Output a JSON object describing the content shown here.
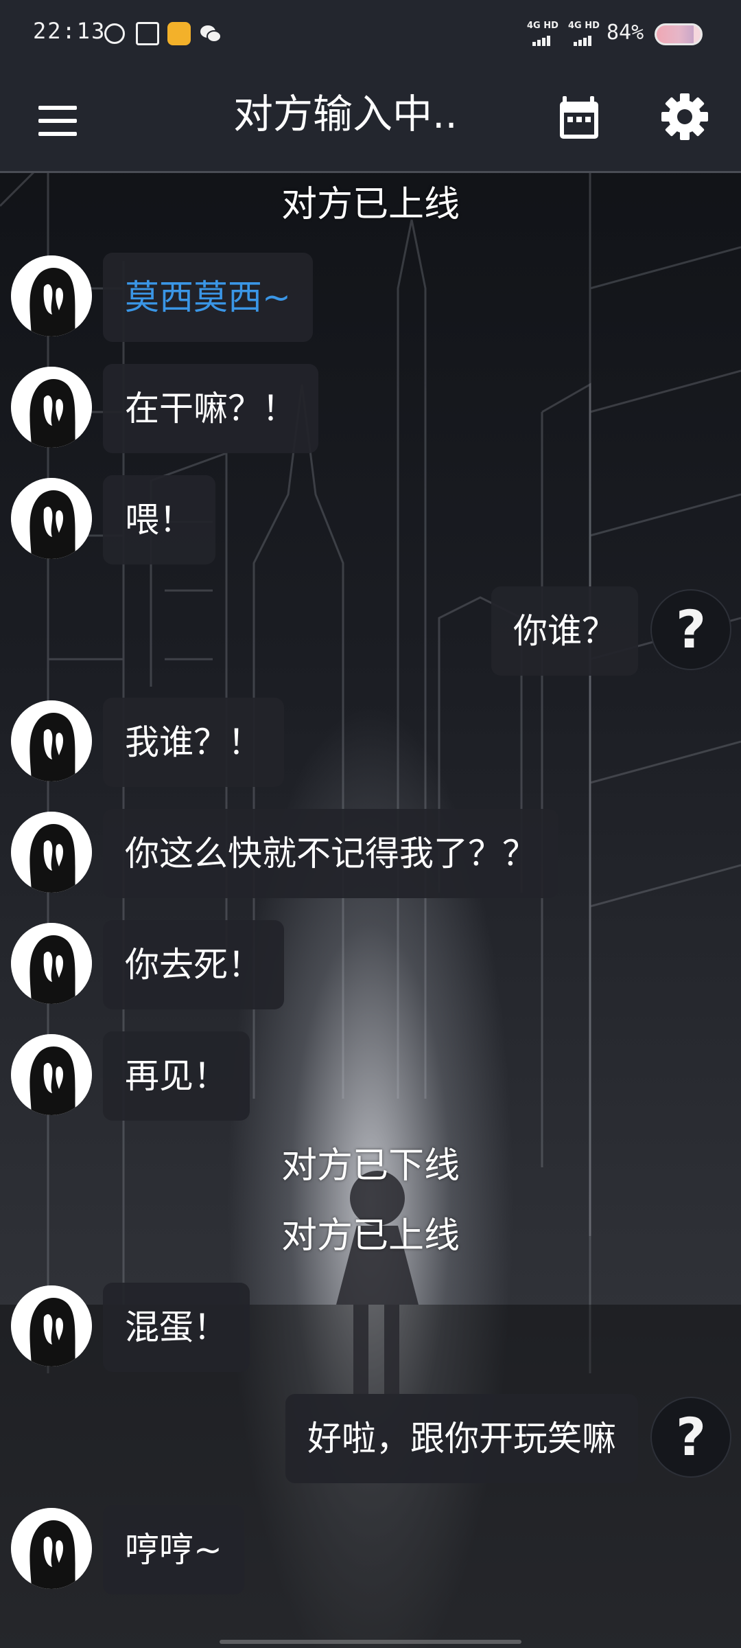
{
  "status_bar": {
    "time": "22:13",
    "notification_icons": [
      "k-app-icon",
      "gift-icon",
      "weibo-icon",
      "wechat-icon"
    ],
    "network": [
      {
        "label": "4G HD",
        "icon": "signal-bars-icon"
      },
      {
        "label": "4G HD",
        "icon": "signal-bars-icon"
      }
    ],
    "battery_text": "84%",
    "battery_level": 0.84
  },
  "header": {
    "menu_icon": "hamburger-menu-icon",
    "title": "对方输入中..",
    "calendar_icon": "calendar-icon",
    "settings_icon": "gear-icon"
  },
  "chat": {
    "notices": [
      "对方已上线",
      "对方已下线",
      "对方已上线"
    ],
    "messages": [
      {
        "side": "left",
        "text": "莫西莫西~",
        "highlight": true
      },
      {
        "side": "left",
        "text": "在干嘛？！"
      },
      {
        "side": "left",
        "text": "喂！"
      },
      {
        "side": "right",
        "text": "你谁？"
      },
      {
        "side": "left",
        "text": "我谁？！"
      },
      {
        "side": "left",
        "text": "你这么快就不记得我了？？"
      },
      {
        "side": "left",
        "text": "你去死！"
      },
      {
        "side": "left",
        "text": "再见！"
      },
      {
        "side": "left",
        "text": "混蛋！"
      },
      {
        "side": "right",
        "text": "好啦，跟你开玩笑嘛"
      },
      {
        "side": "left",
        "text": "哼哼~"
      }
    ],
    "right_avatar_glyph": "?"
  },
  "colors": {
    "header_bg": "#23262e",
    "bubble_bg": "#22242a",
    "highlight_text": "#3a96e6"
  }
}
